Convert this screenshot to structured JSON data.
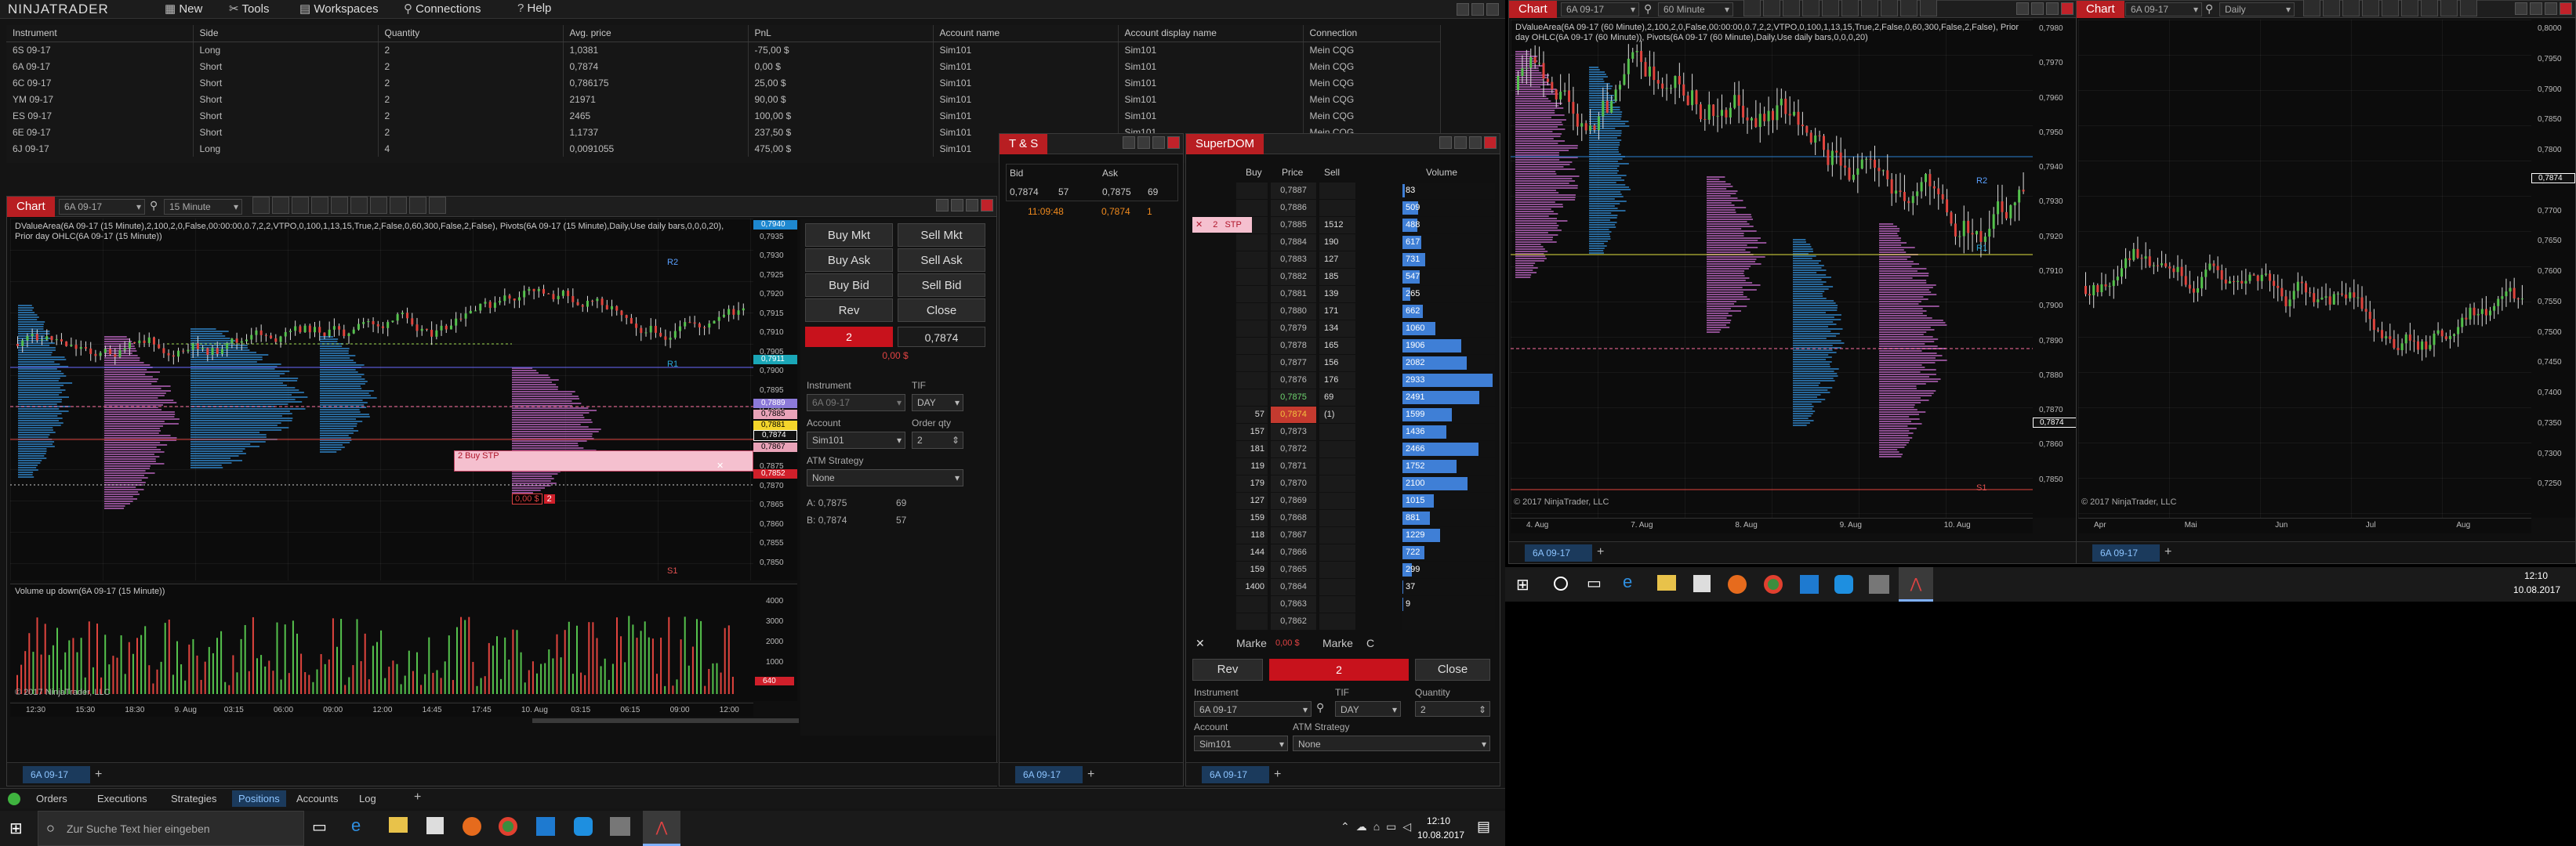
{
  "app": {
    "brand": "NINJATRADER",
    "menu": [
      "New",
      "Tools",
      "Workspaces",
      "Connections",
      "Help"
    ]
  },
  "positions": {
    "headers": [
      "Instrument",
      "Side",
      "Quantity",
      "Avg. price",
      "PnL",
      "Account name",
      "Account display name",
      "Connection"
    ],
    "rows": [
      [
        "6S 09-17",
        "Long",
        "2",
        "1,0381",
        "-75,00 $",
        "Sim101",
        "Sim101",
        "Mein CQG"
      ],
      [
        "6A 09-17",
        "Short",
        "2",
        "0,7874",
        "0,00 $",
        "Sim101",
        "Sim101",
        "Mein CQG"
      ],
      [
        "6C 09-17",
        "Short",
        "2",
        "0,786175",
        "25,00 $",
        "Sim101",
        "Sim101",
        "Mein CQG"
      ],
      [
        "YM 09-17",
        "Short",
        "2",
        "21971",
        "90,00 $",
        "Sim101",
        "Sim101",
        "Mein CQG"
      ],
      [
        "ES 09-17",
        "Short",
        "2",
        "2465",
        "100,00 $",
        "Sim101",
        "Sim101",
        "Mein CQG"
      ],
      [
        "6E 09-17",
        "Short",
        "2",
        "1,1737",
        "237,50 $",
        "Sim101",
        "Sim101",
        "Mein CQG"
      ],
      [
        "6J 09-17",
        "Long",
        "4",
        "0,0091055",
        "475,00 $",
        "Sim101",
        "Sim101",
        "Mein CQG"
      ]
    ],
    "pnl_sign": [
      "neg",
      "neutral",
      "pos",
      "pos",
      "pos",
      "pos",
      "pos"
    ]
  },
  "chart1": {
    "tab": "Chart",
    "instrument": "6A 09-17",
    "interval": "15 Minute",
    "indicator_line": "DValueArea(6A 09-17 (15 Minute),2,100,2,0,False,00:00:00,0.7,2,2,VTPO,0,100,1,13,15,True,2,False,0,60,300,False,2,False), Pivots(6A 09-17 (15 Minute),Daily,Use daily bars,0,0,0,20), Prior day OHLC(6A 09-17 (15 Minute))",
    "price_ticks": [
      "0,7935",
      "0,7930",
      "0,7925",
      "0,7920",
      "0,7915",
      "0,7910",
      "0,7905",
      "0,7900",
      "0,7895",
      "0,7890",
      "0,7885",
      "0,7880",
      "0,7875",
      "0,7870",
      "0,7865",
      "0,7860",
      "0,7855",
      "0,7850"
    ],
    "price_tags": [
      {
        "text": "0,7940",
        "color": "#1e88d0"
      },
      {
        "text": "0,7911",
        "color": "#1aa6b7"
      },
      {
        "text": "0,7889",
        "color": "#8c7ad9"
      },
      {
        "text": "0,7885",
        "color": "#e9a3b8"
      },
      {
        "text": "0,7881",
        "color": "#f4d52b"
      },
      {
        "text": "0,7874",
        "color": "#111111"
      },
      {
        "text": "0,7867",
        "color": "#e9a3b8"
      },
      {
        "text": "0,7852",
        "color": "#d01f2a"
      }
    ],
    "levels": [
      "R2",
      "R1",
      "S1"
    ],
    "order_label": "2 Buy STP",
    "pos_label_left": "0,00 $",
    "pos_label_qty": "2",
    "x_ticks": [
      "12:30",
      "15:30",
      "18:30",
      "9. Aug",
      "03:15",
      "06:00",
      "09:00",
      "12:00",
      "14:45",
      "17:45",
      "10. Aug",
      "03:15",
      "06:15",
      "09:00",
      "12:00"
    ],
    "volume_label": "Volume up down(6A 09-17 (15 Minute))",
    "volume_ticks": [
      "4000",
      "3000",
      "2000",
      "1000"
    ],
    "volume_tag": "640",
    "copyright": "© 2017 NinjaTrader, LLC",
    "bottom_tab": "6A 09-17"
  },
  "chart_trader": {
    "buy_mkt": "Buy Mkt",
    "sell_mkt": "Sell Mkt",
    "buy_ask": "Buy Ask",
    "sell_ask": "Sell Ask",
    "buy_bid": "Buy Bid",
    "sell_bid": "Sell Bid",
    "rev": "Rev",
    "close": "Close",
    "qty": "2",
    "avg": "0,7874",
    "pnl": "0,00 $",
    "instrument_label": "Instrument",
    "instrument_value": "6A 09-17",
    "tif_label": "TIF",
    "tif_value": "DAY",
    "account_label": "Account",
    "account_value": "Sim101",
    "order_qty_label": "Order qty",
    "order_qty_value": "2",
    "atm_label": "ATM Strategy",
    "atm_value": "None",
    "ask_line_label": "A:",
    "ask_line_price": "0,7875",
    "ask_line_size": "69",
    "bid_line_label": "B:",
    "bid_line_price": "0,7874",
    "bid_line_size": "57"
  },
  "ts": {
    "title": "T & S",
    "bid_label": "Bid",
    "ask_label": "Ask",
    "bid_price": "0,7874",
    "bid_size": "57",
    "ask_price": "0,7875",
    "ask_size": "69",
    "trade_time": "11:09:48",
    "trade_price": "0,7874",
    "trade_size": "1",
    "bottom_tab": "6A 09-17"
  },
  "superdom": {
    "title": "SuperDOM",
    "col_buy": "Buy",
    "col_price": "Price",
    "col_sell": "Sell",
    "col_volume": "Volume",
    "order_badge": "2",
    "order_type": "STP",
    "rows": [
      {
        "buy": "",
        "price": "0,7887",
        "sell": "",
        "vol": "83"
      },
      {
        "buy": "",
        "price": "0,7886",
        "sell": "",
        "vol": "509"
      },
      {
        "buy": "",
        "price": "0,7885",
        "sell": "1512",
        "vol": "488"
      },
      {
        "buy": "",
        "price": "0,7884",
        "sell": "190",
        "vol": "617"
      },
      {
        "buy": "",
        "price": "0,7883",
        "sell": "127",
        "vol": "731"
      },
      {
        "buy": "",
        "price": "0,7882",
        "sell": "185",
        "vol": "547"
      },
      {
        "buy": "",
        "price": "0,7881",
        "sell": "139",
        "vol": "265"
      },
      {
        "buy": "",
        "price": "0,7880",
        "sell": "171",
        "vol": "662"
      },
      {
        "buy": "",
        "price": "0,7879",
        "sell": "134",
        "vol": "1060"
      },
      {
        "buy": "",
        "price": "0,7878",
        "sell": "165",
        "vol": "1906"
      },
      {
        "buy": "",
        "price": "0,7877",
        "sell": "156",
        "vol": "2082"
      },
      {
        "buy": "",
        "price": "0,7876",
        "sell": "176",
        "vol": "2933"
      },
      {
        "buy": "",
        "price": "0,7875",
        "sell": "69",
        "vol": "2491"
      },
      {
        "buy": "57",
        "price": "0,7874",
        "sell": "(1)",
        "vol": "1599"
      },
      {
        "buy": "157",
        "price": "0,7873",
        "sell": "",
        "vol": "1436"
      },
      {
        "buy": "181",
        "price": "0,7872",
        "sell": "",
        "vol": "2466"
      },
      {
        "buy": "119",
        "price": "0,7871",
        "sell": "",
        "vol": "1752"
      },
      {
        "buy": "179",
        "price": "0,7870",
        "sell": "",
        "vol": "2100"
      },
      {
        "buy": "127",
        "price": "0,7869",
        "sell": "",
        "vol": "1015"
      },
      {
        "buy": "159",
        "price": "0,7868",
        "sell": "",
        "vol": "881"
      },
      {
        "buy": "118",
        "price": "0,7867",
        "sell": "",
        "vol": "1229"
      },
      {
        "buy": "144",
        "price": "0,7866",
        "sell": "",
        "vol": "722"
      },
      {
        "buy": "159",
        "price": "0,7865",
        "sell": "",
        "vol": "299"
      },
      {
        "buy": "1400",
        "price": "0,7864",
        "sell": "",
        "vol": "37"
      },
      {
        "buy": "",
        "price": "0,7863",
        "sell": "",
        "vol": "9"
      },
      {
        "buy": "",
        "price": "0,7862",
        "sell": "",
        "vol": ""
      }
    ],
    "market_left": "Marke",
    "market_pnl": "0,00 $",
    "market_right": "Marke",
    "market_c": "C",
    "rev": "Rev",
    "qty": "2",
    "close": "Close",
    "instrument_label": "Instrument",
    "instrument_value": "6A 09-17",
    "tif_label": "TIF",
    "tif_value": "DAY",
    "quantity_label": "Quantity",
    "quantity_value": "2",
    "account_label": "Account",
    "account_value": "Sim101",
    "atm_label": "ATM Strategy",
    "atm_value": "None",
    "bottom_tab": "6A 09-17"
  },
  "chart2": {
    "tab": "Chart",
    "instrument": "6A 09-17",
    "interval": "60 Minute",
    "indicator_line": "DValueArea(6A 09-17 (60 Minute),2,100,2,0,False,00:00:00,0.7,2,2,VTPO,0,100,1,13,15,True,2,False,0,60,300,False,2,False), Prior day OHLC(6A 09-17 (60 Minute)), Pivots(6A 09-17 (60 Minute),Daily,Use daily bars,0,0,0,20)",
    "price_ticks": [
      "0,7980",
      "0,7970",
      "0,7960",
      "0,7950",
      "0,7940",
      "0,7930",
      "0,7920",
      "0,7910",
      "0,7900",
      "0,7890",
      "0,7880",
      "0,7870",
      "0,7860",
      "0,7850"
    ],
    "last_tag": "0,7874",
    "levels": [
      "R2",
      "R1",
      "S1"
    ],
    "x_ticks": [
      "4. Aug",
      "7. Aug",
      "8. Aug",
      "9. Aug",
      "10. Aug"
    ],
    "copyright": "© 2017 NinjaTrader, LLC",
    "bottom_tab": "6A 09-17"
  },
  "chart3": {
    "tab": "Chart",
    "instrument": "6A 09-17",
    "interval": "Daily",
    "price_ticks": [
      "0,8000",
      "0,7950",
      "0,7900",
      "0,7850",
      "0,7800",
      "0,7750",
      "0,7700",
      "0,7650",
      "0,7600",
      "0,7550",
      "0,7500",
      "0,7450",
      "0,7400",
      "0,7350",
      "0,7300",
      "0,7250"
    ],
    "last_tag": "0,7874",
    "x_ticks": [
      "Apr",
      "Mai",
      "Jun",
      "Jul",
      "Aug"
    ],
    "copyright": "© 2017 NinjaTrader, LLC",
    "bottom_tab": "6A 09-17"
  },
  "bottom_tabs": [
    "Orders",
    "Executions",
    "Strategies",
    "Positions",
    "Accounts",
    "Log"
  ],
  "active_bottom_tab": "Positions",
  "taskbar_left": {
    "search_placeholder": "Zur Suche Text hier eingeben",
    "time": "12:10",
    "date": "10.08.2017"
  },
  "taskbar_right": {
    "time": "12:10",
    "date": "10.08.2017"
  }
}
